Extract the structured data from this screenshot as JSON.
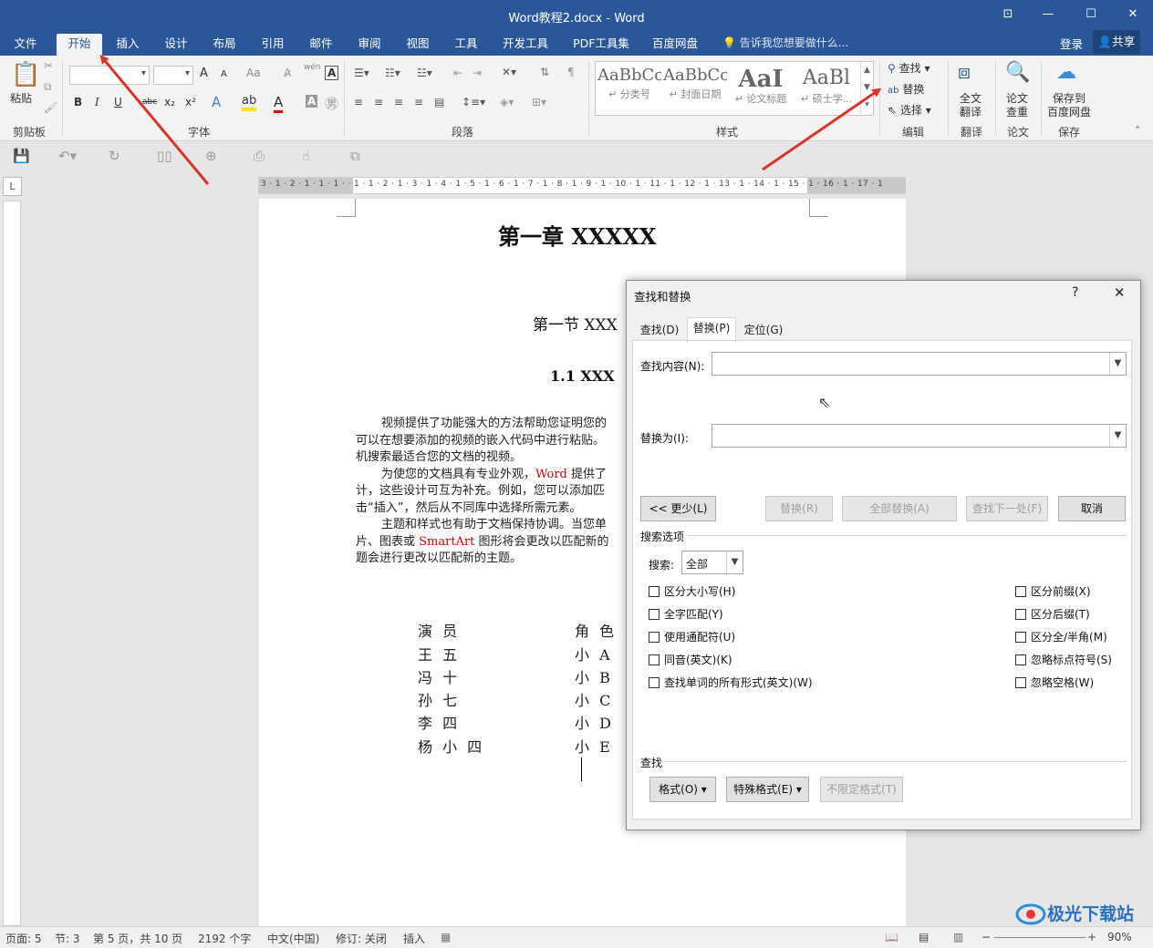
{
  "window": {
    "title": "Word教程2.docx - Word"
  },
  "menu": {
    "tabs": [
      "文件",
      "开始",
      "插入",
      "设计",
      "布局",
      "引用",
      "邮件",
      "审阅",
      "视图",
      "工具",
      "开发工具",
      "PDF工具集",
      "百度网盘"
    ],
    "active": "开始",
    "tellme": "告诉我您想要做什么...",
    "login": "登录",
    "share": "共享"
  },
  "ribbon": {
    "clipboard": {
      "paste": "粘贴",
      "group": "剪贴板"
    },
    "font": {
      "group": "字体",
      "bold": "B",
      "italic": "I",
      "underline": "U",
      "strike": "abc",
      "sub": "x₂",
      "sup": "x²",
      "grow": "A",
      "shrink": "A",
      "case": "Aa",
      "wen": "wén",
      "textA": "A"
    },
    "paragraph": {
      "group": "段落"
    },
    "styles": {
      "group": "样式",
      "items": [
        {
          "preview": "AaBbCc",
          "name": "↵ 分类号"
        },
        {
          "preview": "AaBbCc",
          "name": "↵ 封面日期"
        },
        {
          "preview": "AaI",
          "name": "↵ 论文标题"
        },
        {
          "preview": "AaBl",
          "name": "↵ 硕士学..."
        }
      ]
    },
    "editing": {
      "group": "编辑",
      "find": "查找",
      "replace": "替换",
      "select": "选择"
    },
    "translate": {
      "label1": "全文",
      "label2": "翻译",
      "group": "翻译"
    },
    "paper": {
      "label1": "论文",
      "label2": "查重",
      "group": "论文"
    },
    "save": {
      "label1": "保存到",
      "label2": "百度网盘",
      "group": "保存"
    }
  },
  "ruler": {
    "left_corner": "L",
    "ticks": "3 · 1 · 2 · 1 · 1 · 1 · · 1 · 1 · 2 · 1 · 3 · 1 · 4 · 1 · 5 · 1 · 6 · 1 · 7 · 1 · 8 · 1 · 9 · 1 · 10 · 1 · 11 · 1 · 12 · 1 · 13 · 1 · 14 · 1 · 15 · 1 · 16 · 1 · 17 · 1"
  },
  "document": {
    "chapter": "第一章  XXXXX",
    "section": "第一节  XXX",
    "subsection": "1.1 XXX",
    "p1": [
      "视频提供了功能强大的方法帮助您证明您的",
      "可以在想要添加的视频的嵌入代码中进行粘贴。",
      "机搜索最适合您的文档的视频。"
    ],
    "p2a": "为使您的文档具有专业外观，",
    "p2word": "Word",
    "p2b": " 提供了",
    "p2rest": [
      "计，这些设计可互为补充。例如，您可以添加匹",
      "击“插入”，然后从不同库中选择所需元素。"
    ],
    "p3a": "主题和样式也有助于文档保持协调。当您单",
    "p3b": "片、图表或 ",
    "p3smart": "SmartArt",
    "p3c": " 图形将会更改以匹配新的",
    "p3d": "题会进行更改以匹配新的主题。",
    "table_headers": [
      "演  员",
      "角 色"
    ],
    "table_rows": [
      [
        "王  五",
        "小  A"
      ],
      [
        "冯  十",
        "小  B"
      ],
      [
        "孙  七",
        "小  C"
      ],
      [
        "李  四",
        "小  D"
      ],
      [
        "杨 小 四",
        "小  E"
      ]
    ]
  },
  "dialog": {
    "title": "查找和替换",
    "help": "?",
    "close": "✕",
    "tabs": [
      "查找(D)",
      "替换(P)",
      "定位(G)"
    ],
    "active_tab": "替换(P)",
    "find_label": "查找内容(N):",
    "find_value": "",
    "replace_label": "替换为(I):",
    "replace_value": "",
    "buttons": {
      "less": "<< 更少(L)",
      "replace": "替换(R)",
      "replace_all": "全部替换(A)",
      "find_next": "查找下一处(F)",
      "cancel": "取消"
    },
    "search_options_label": "搜索选项",
    "search_label": "搜索:",
    "search_value": "全部",
    "left_options": [
      "区分大小写(H)",
      "全字匹配(Y)",
      "使用通配符(U)",
      "同音(英文)(K)",
      "查找单词的所有形式(英文)(W)"
    ],
    "right_options": [
      "区分前缀(X)",
      "区分后缀(T)",
      "区分全/半角(M)",
      "忽略标点符号(S)",
      "忽略空格(W)"
    ],
    "find_section": "查找",
    "bottom": {
      "format": "格式(O) ▾",
      "special": "特殊格式(E) ▾",
      "no_format": "不限定格式(T)"
    }
  },
  "status": {
    "page": "页面: 5",
    "section": "节: 3",
    "pages": "第 5 页，共 10 页",
    "words": "2192 个字",
    "lang": "中文(中国)",
    "track": "修订: 关闭",
    "insert": "插入",
    "zoom": "90%"
  },
  "watermark": "极光下载站",
  "colors": {
    "brand": "#2b579a",
    "arrow": "#d9342b",
    "red_text": "#dd0000"
  }
}
